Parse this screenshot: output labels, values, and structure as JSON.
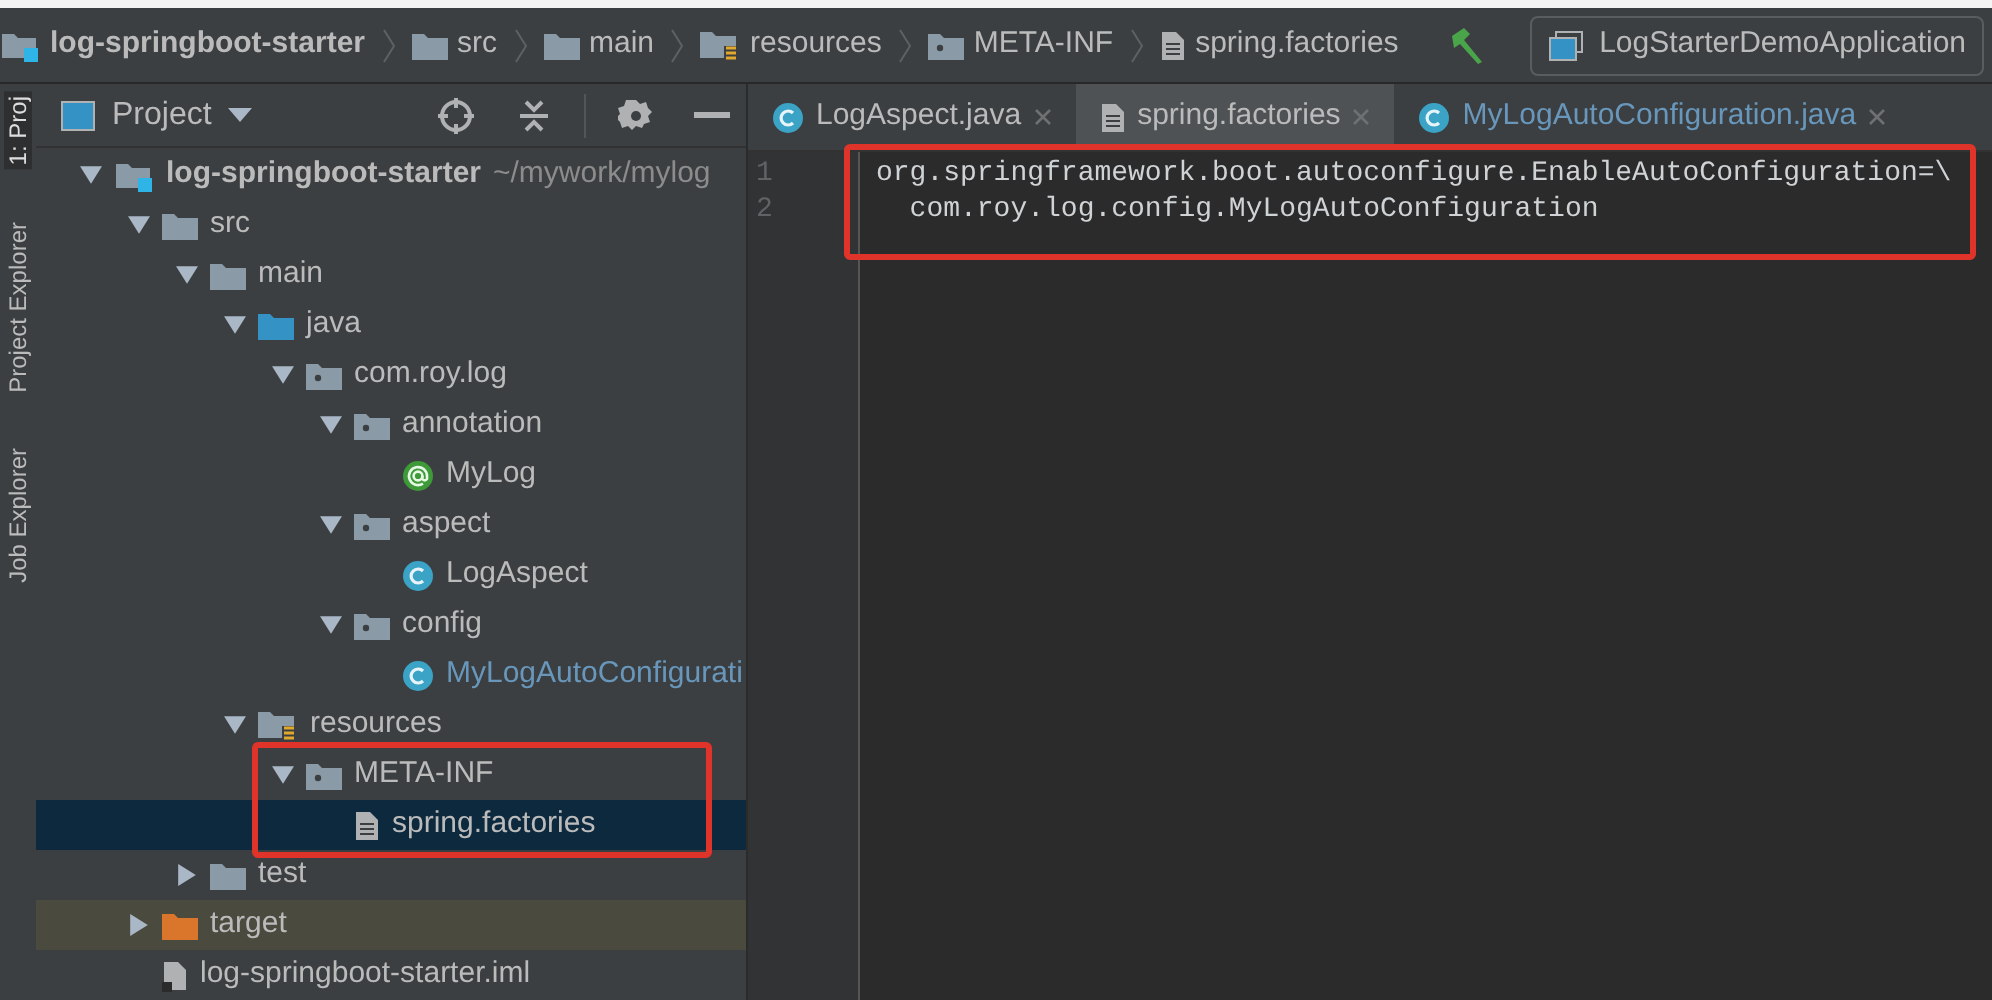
{
  "breadcrumbs": [
    {
      "kind": "module",
      "label": "log-springboot-starter"
    },
    {
      "kind": "folder",
      "label": "src"
    },
    {
      "kind": "folder",
      "label": "main"
    },
    {
      "kind": "resources",
      "label": "resources"
    },
    {
      "kind": "package",
      "label": "META-INF"
    },
    {
      "kind": "file",
      "label": "spring.factories"
    }
  ],
  "run_config": "LogStarterDemoApplication",
  "side_tabs": [
    {
      "label": "1: Proj",
      "selected": true
    },
    {
      "label": "Project Explorer",
      "selected": false
    },
    {
      "label": "Job Explorer",
      "selected": false
    }
  ],
  "project_panel": {
    "title": "Project"
  },
  "tree": [
    {
      "kind": "module",
      "label": "log-springboot-starter",
      "path": "~/mywork/mylog",
      "expanded": true,
      "selected": false,
      "children": [
        {
          "kind": "folder",
          "label": "src",
          "expanded": true,
          "selected": false,
          "children": [
            {
              "kind": "folder",
              "label": "main",
              "expanded": true,
              "selected": false,
              "children": [
                {
                  "kind": "source",
                  "label": "java",
                  "expanded": true,
                  "selected": false,
                  "children": [
                    {
                      "kind": "package",
                      "label": "com.roy.log",
                      "expanded": true,
                      "selected": false,
                      "children": [
                        {
                          "kind": "package",
                          "label": "annotation",
                          "expanded": true,
                          "selected": false,
                          "children": [
                            {
                              "kind": "annotation",
                              "label": "MyLog",
                              "selected": false
                            }
                          ]
                        },
                        {
                          "kind": "package",
                          "label": "aspect",
                          "expanded": true,
                          "selected": false,
                          "children": [
                            {
                              "kind": "class",
                              "label": "LogAspect",
                              "selected": false
                            }
                          ]
                        },
                        {
                          "kind": "package",
                          "label": "config",
                          "expanded": true,
                          "selected": false,
                          "children": [
                            {
                              "kind": "class",
                              "label": "MyLogAutoConfigurati",
                              "selected": false,
                              "modified": true
                            }
                          ]
                        }
                      ]
                    }
                  ]
                },
                {
                  "kind": "resources",
                  "label": "resources",
                  "expanded": true,
                  "selected": false,
                  "children": [
                    {
                      "kind": "package",
                      "label": "META-INF",
                      "expanded": true,
                      "selected": false,
                      "highlight": true,
                      "children": [
                        {
                          "kind": "file",
                          "label": "spring.factories",
                          "selected": true
                        }
                      ]
                    }
                  ]
                }
              ]
            },
            {
              "kind": "folder",
              "label": "test",
              "expanded": false,
              "selected": false
            }
          ]
        },
        {
          "kind": "excluded",
          "label": "target",
          "expanded": false,
          "selected": false
        },
        {
          "kind": "iml",
          "label": "log-springboot-starter.iml",
          "selected": false
        }
      ]
    }
  ],
  "tabs": [
    {
      "kind": "class",
      "label": "LogAspect.java",
      "selected": false
    },
    {
      "kind": "file",
      "label": "spring.factories",
      "selected": true
    },
    {
      "kind": "class",
      "label": "MyLogAutoConfiguration.java",
      "selected": false
    }
  ],
  "editor": {
    "highlight": true,
    "lines": [
      {
        "number": "1",
        "text": "org.springframework.boot.autoconfigure.EnableAutoConfiguration=\\"
      },
      {
        "number": "2",
        "text": "  com.roy.log.config.MyLogAutoConfiguration"
      }
    ]
  }
}
